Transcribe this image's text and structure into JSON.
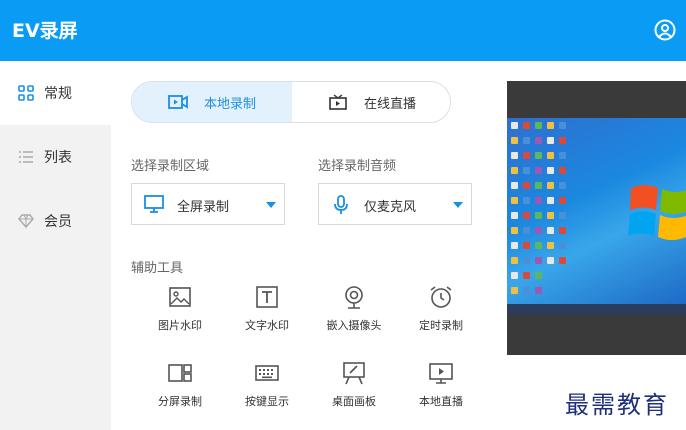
{
  "header": {
    "title": "EV录屏",
    "user_icon": "user-icon"
  },
  "sidebar": {
    "items": [
      {
        "label": "常规",
        "icon": "grid-icon",
        "active": true
      },
      {
        "label": "列表",
        "icon": "list-icon",
        "active": false
      },
      {
        "label": "会员",
        "icon": "diamond-icon",
        "active": false
      }
    ]
  },
  "mode_tabs": [
    {
      "label": "本地录制",
      "icon": "video-record-icon",
      "active": true
    },
    {
      "label": "在线直播",
      "icon": "tv-icon",
      "active": false
    }
  ],
  "region": {
    "label": "选择录制区域",
    "value": "全屏录制",
    "icon": "monitor-icon"
  },
  "audio": {
    "label": "选择录制音频",
    "value": "仅麦克风",
    "icon": "microphone-icon"
  },
  "tools": {
    "label": "辅助工具",
    "items": [
      {
        "label": "图片水印",
        "icon": "image-icon"
      },
      {
        "label": "文字水印",
        "icon": "text-icon"
      },
      {
        "label": "嵌入摄像头",
        "icon": "webcam-icon"
      },
      {
        "label": "定时录制",
        "icon": "alarm-clock-icon"
      },
      {
        "label": "分屏录制",
        "icon": "split-screen-icon"
      },
      {
        "label": "按键显示",
        "icon": "keyboard-icon"
      },
      {
        "label": "桌面画板",
        "icon": "easel-icon"
      },
      {
        "label": "本地直播",
        "icon": "play-screen-icon"
      }
    ]
  },
  "watermark": "最需教育",
  "colors": {
    "accent": "#0a9cf5",
    "tab_active_bg": "#e3f1fc",
    "tab_active_text": "#1a8fe3",
    "sidebar_bg": "#f2f2f2"
  }
}
